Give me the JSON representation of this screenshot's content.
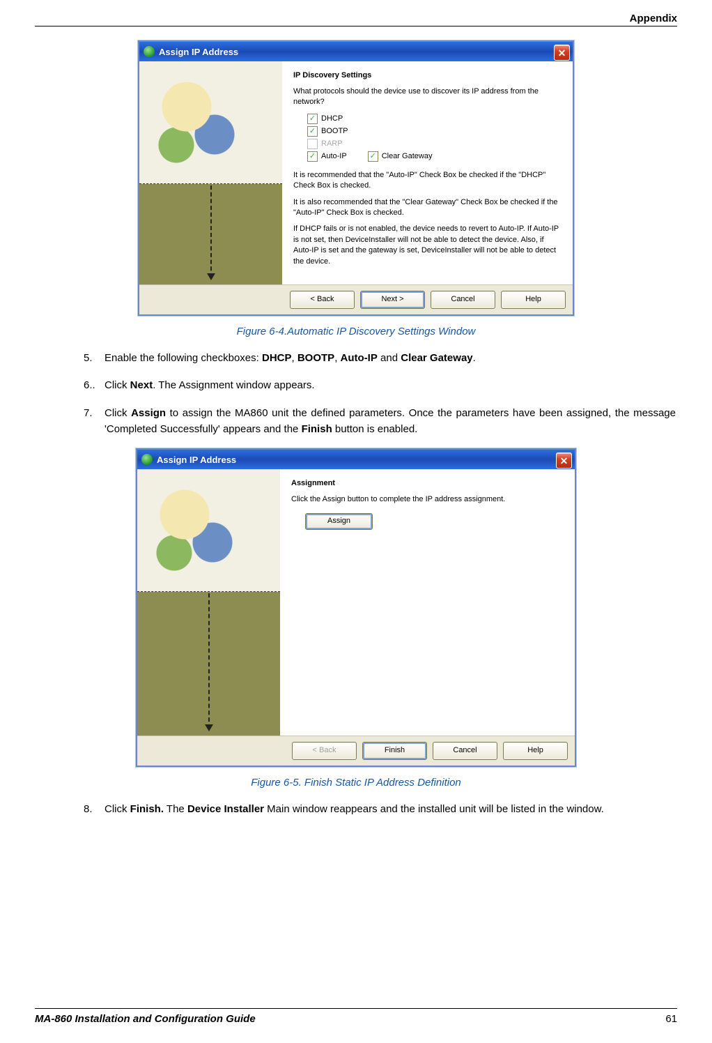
{
  "header": {
    "section": "Appendix"
  },
  "dialog1": {
    "title": "Assign IP Address",
    "heading": "IP Discovery Settings",
    "question": "What protocols should the device use to discover its IP address from the network?",
    "checkboxes": {
      "dhcp": "DHCP",
      "bootp": "BOOTP",
      "rarp": "RARP",
      "autoip": "Auto-IP",
      "cleargw": "Clear Gateway"
    },
    "rec1": "It is recommended that the \"Auto-IP\" Check Box be checked if the \"DHCP\" Check Box is checked.",
    "rec2": "It is also recommended that the \"Clear Gateway\" Check Box be checked if the \"Auto-IP\" Check Box is checked.",
    "rec3": "If DHCP fails or is not enabled, the device needs to revert to Auto-IP.  If Auto-IP is not set, then DeviceInstaller will not be able to detect the device.  Also, if Auto-IP is set and the gateway is set, DeviceInstaller will not be able to detect the device.",
    "buttons": {
      "back": "< Back",
      "next": "Next >",
      "cancel": "Cancel",
      "help": "Help"
    }
  },
  "caption1": "Figure 6-4.Automatic  IP Discovery Settings Window",
  "steps": {
    "s5": {
      "num": "5.",
      "pre": "Enable the following checkboxes: ",
      "b1": "DHCP",
      "c1": ", ",
      "b2": "BOOTP",
      "c2": ", ",
      "b3": "Auto-IP",
      "c3": " and ",
      "b4": "Clear Gateway",
      "end": "."
    },
    "s6": {
      "num": "6..",
      "pre": "Click ",
      "b1": "Next",
      "post": ". The Assignment window appears."
    },
    "s7": {
      "num": "7.",
      "pre": "Click ",
      "b1": "Assign",
      "mid": " to assign the MA860 unit the defined parameters. Once the parameters have been assigned, the message 'Completed Successfully' appears and the ",
      "b2": "Finish",
      "post": " button is enabled."
    },
    "s8": {
      "num": "8.",
      "pre": "Click ",
      "b1": "Finish.",
      "mid": " The ",
      "b2": "Device Installer",
      "post": " Main window reappears and the installed unit will be listed in the window."
    }
  },
  "dialog2": {
    "title": "Assign IP Address",
    "heading": "Assignment",
    "text": "Click the Assign button to complete the IP address assignment.",
    "assign_btn": "Assign",
    "buttons": {
      "back": "< Back",
      "finish": "Finish",
      "cancel": "Cancel",
      "help": "Help"
    }
  },
  "caption2": "Figure 6-5. Finish Static IP Address Definition",
  "footer": {
    "guide": "MA-860 Installation and Configuration Guide",
    "page": "61"
  }
}
